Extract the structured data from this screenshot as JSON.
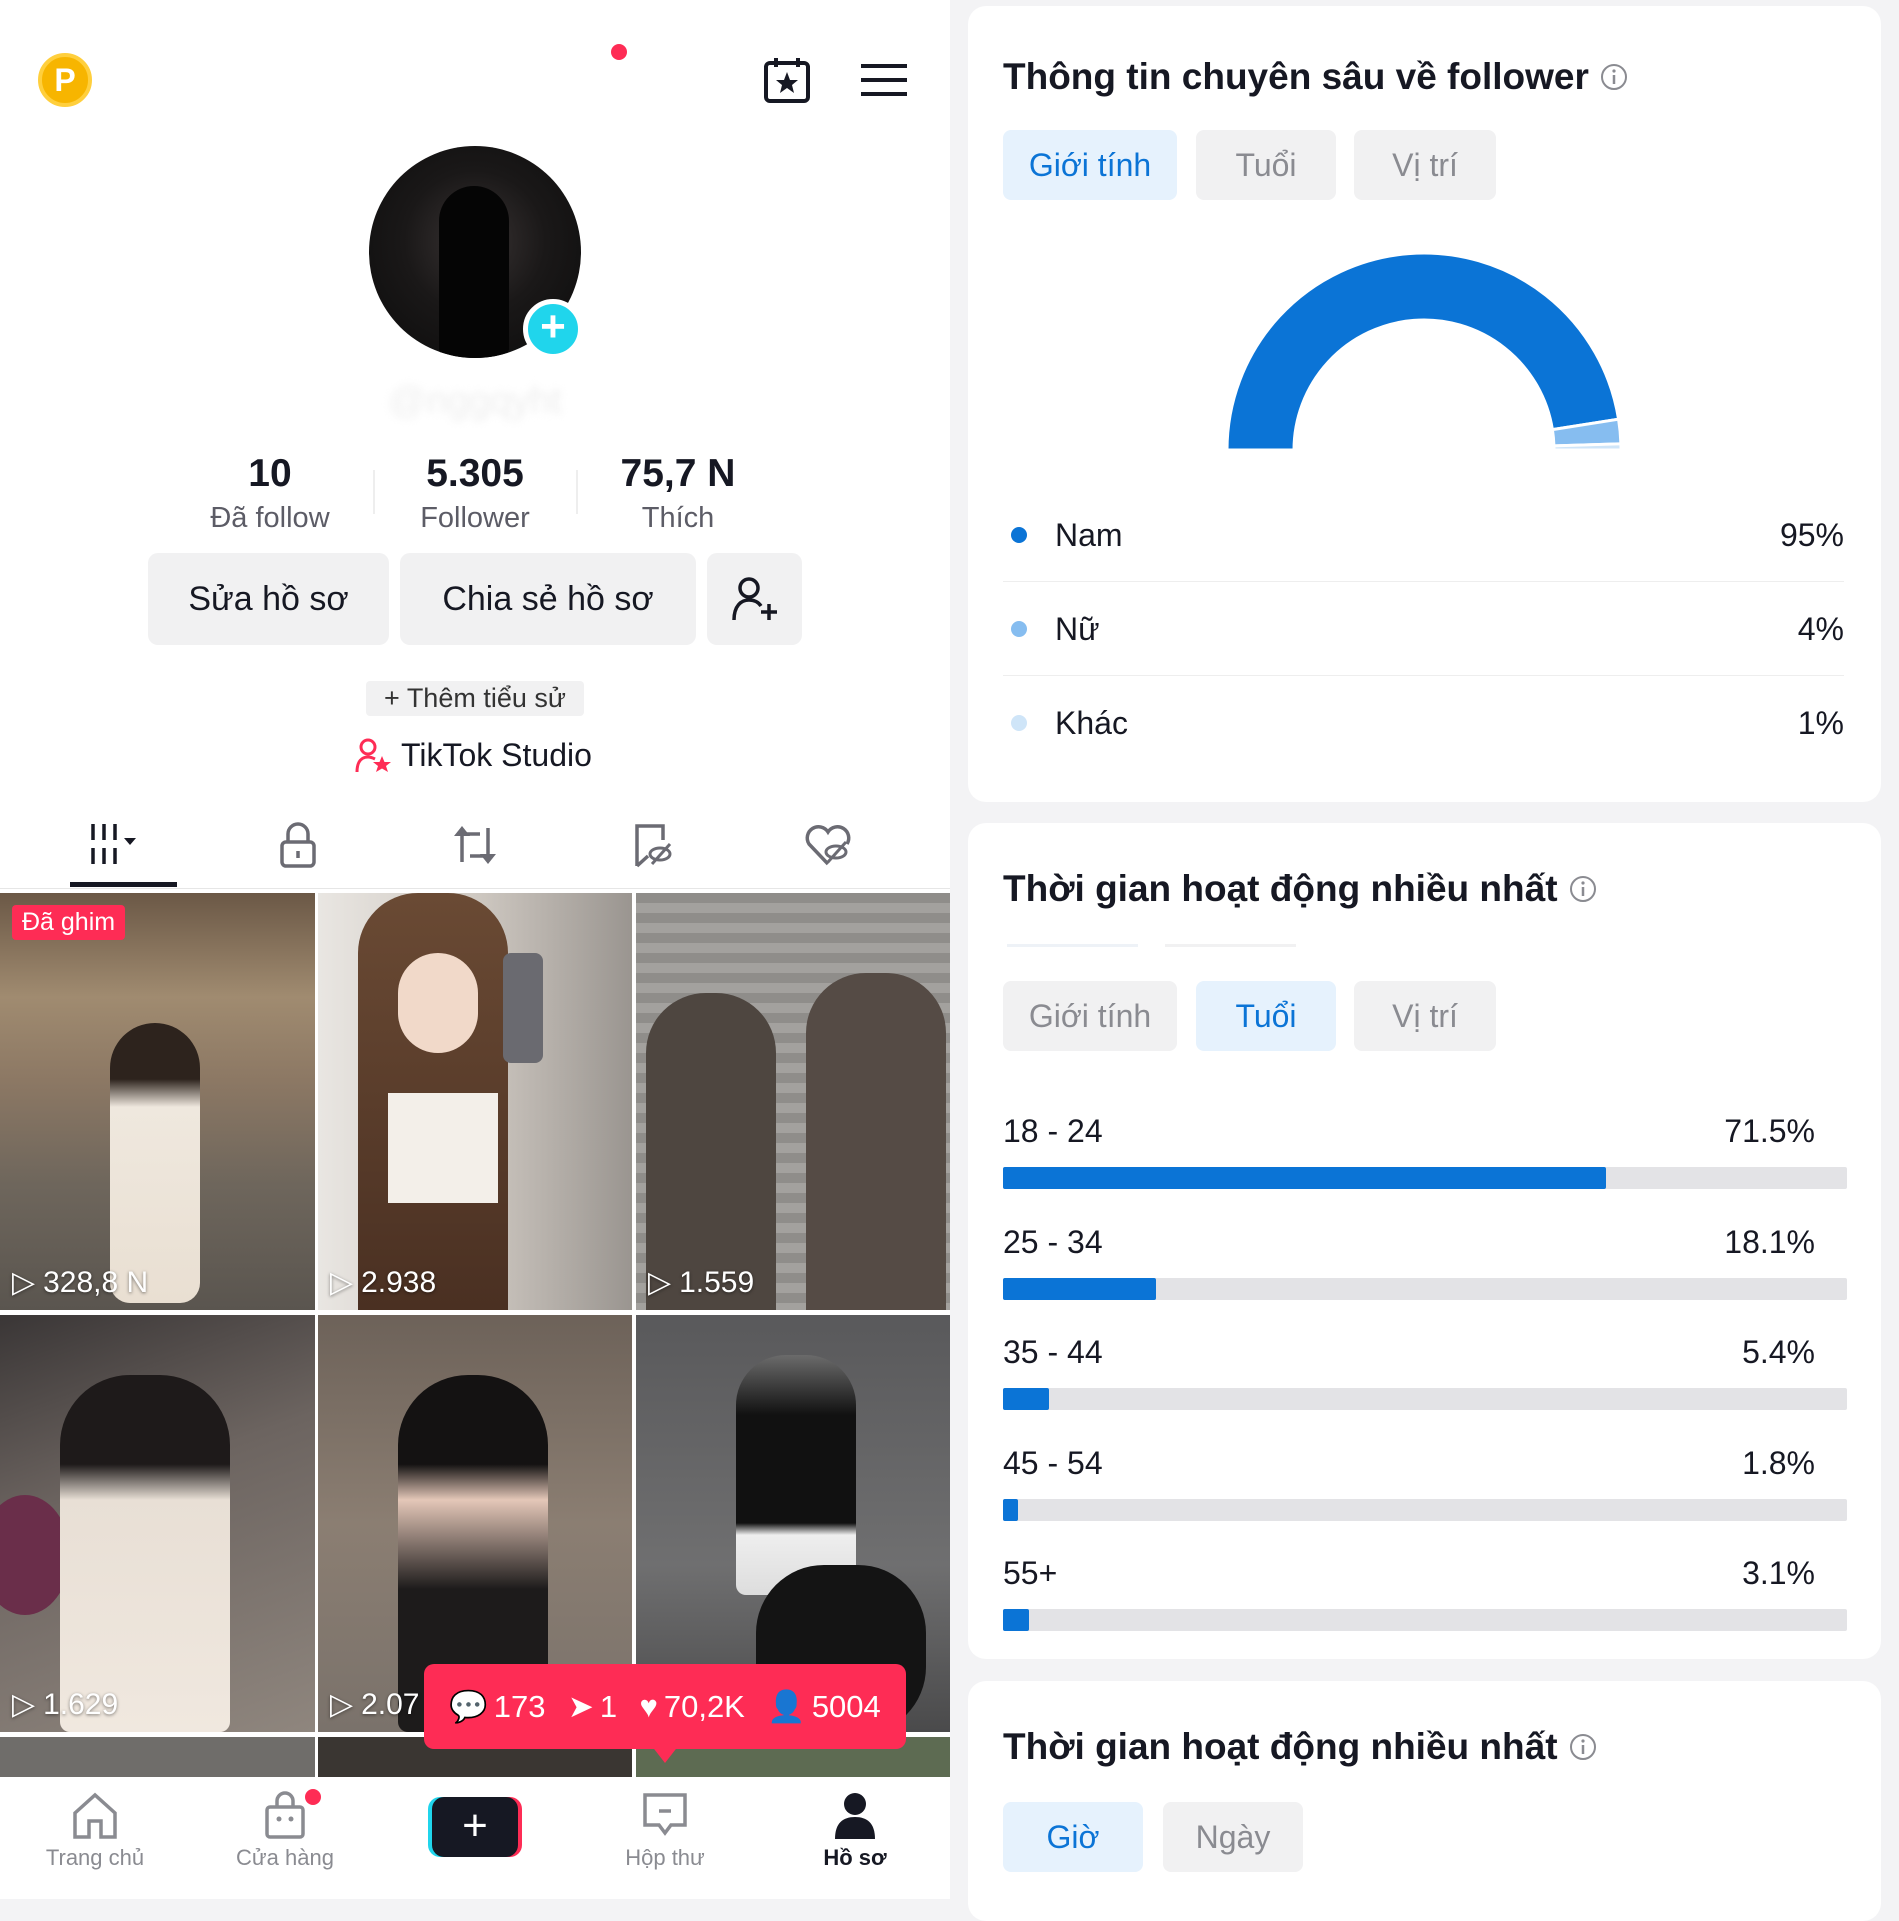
{
  "header": {
    "coin_icon": "P",
    "calendar_icon": "calendar-star-icon",
    "menu_icon": "hamburger-menu-icon"
  },
  "profile": {
    "username": "@nggqyht",
    "stats": [
      {
        "value": "10",
        "label": "Đã follow"
      },
      {
        "value": "5.305",
        "label": "Follower"
      },
      {
        "value": "75,7 N",
        "label": "Thích"
      }
    ],
    "edit_label": "Sửa hồ sơ",
    "share_label": "Chia sẻ hồ sơ",
    "bio_label": "+ Thêm tiểu sử",
    "studio_label": "TikTok Studio"
  },
  "content_tabs": [
    "videos-grid-icon",
    "lock-icon",
    "repost-icon",
    "bookmark-hidden-icon",
    "heart-hidden-icon"
  ],
  "videos": [
    {
      "views": "328,8 N",
      "pinned": "Đã ghim"
    },
    {
      "views": "2.938"
    },
    {
      "views": "1.559"
    },
    {
      "views": "1.629"
    },
    {
      "views": "2.07"
    },
    {
      "views": ""
    }
  ],
  "tooltip": {
    "comments": "173",
    "shares": "1",
    "likes": "70,2K",
    "followers": "5004"
  },
  "bottom_nav": [
    {
      "label": "Trang chủ"
    },
    {
      "label": "Cửa hàng"
    },
    {
      "label": ""
    },
    {
      "label": "Hộp thư"
    },
    {
      "label": "Hồ sơ"
    }
  ],
  "colors": {
    "accent": "#fe2c55",
    "blue": "#0b74d6",
    "light_blue": "#86bdf0",
    "lightest_blue": "#cfe5f8",
    "teal": "#20d5ec"
  },
  "insights": {
    "title": "Thông tin chuyên sâu về follower",
    "tabs": [
      "Giới tính",
      "Tuổi",
      "Vị trí"
    ],
    "active_tab": 0
  },
  "age_card": {
    "title": "Thời gian hoạt động nhiều nhất",
    "tabs": [
      "Giới tính",
      "Tuổi",
      "Vị trí"
    ],
    "active_tab": 1
  },
  "time_card": {
    "title": "Thời gian hoạt động nhiều nhất",
    "tabs": [
      "Giờ",
      "Ngày"
    ],
    "active_tab": 0
  },
  "chart_data": [
    {
      "type": "pie",
      "variant": "half-donut",
      "categories": [
        "Nam",
        "Nữ",
        "Khác"
      ],
      "values": [
        95,
        4,
        1
      ],
      "labels": [
        "95%",
        "4%",
        "1%"
      ],
      "colors": [
        "#0b74d6",
        "#86bdf0",
        "#cfe5f8"
      ]
    },
    {
      "type": "bar",
      "orientation": "horizontal",
      "categories": [
        "18 - 24",
        "25 - 34",
        "35 - 44",
        "45 - 54",
        "55+"
      ],
      "values": [
        71.5,
        18.1,
        5.4,
        1.8,
        3.1
      ],
      "labels": [
        "71.5%",
        "18.1%",
        "5.4%",
        "1.8%",
        "3.1%"
      ],
      "xlim": [
        0,
        100
      ]
    }
  ]
}
